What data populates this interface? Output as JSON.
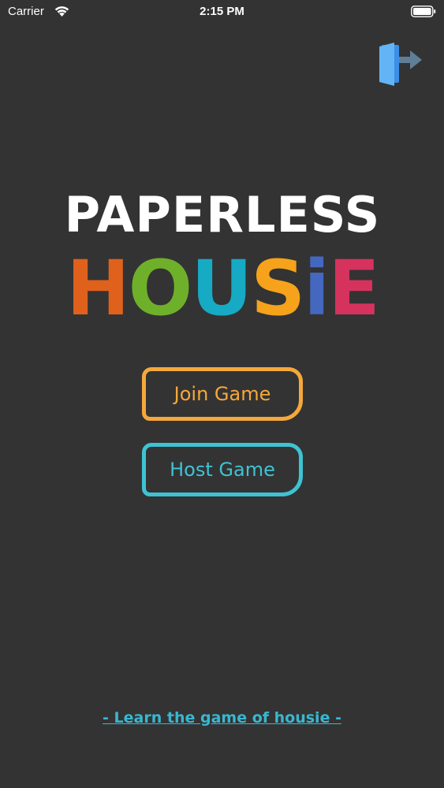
{
  "status_bar": {
    "carrier": "Carrier",
    "time": "2:15 PM",
    "wifi_icon": "wifi-icon",
    "battery_icon": "battery-icon"
  },
  "header": {
    "exit_icon": "exit-door-icon"
  },
  "logo": {
    "line1": "PAPERLESS",
    "letters": [
      {
        "char": "H",
        "color": "#e0611c"
      },
      {
        "char": "O",
        "color": "#6fb02a"
      },
      {
        "char": "U",
        "color": "#16aac4"
      },
      {
        "char": "S",
        "color": "#f6a21b"
      },
      {
        "char": "i",
        "color": "#4468c0"
      },
      {
        "char": "E",
        "color": "#d5335d"
      }
    ]
  },
  "buttons": {
    "join_label": "Join Game",
    "host_label": "Host Game"
  },
  "footer": {
    "learn_link": "- Learn the game of housie -"
  },
  "colors": {
    "background": "#333334",
    "join_accent": "#f5a83a",
    "host_accent": "#3ec3d3",
    "link": "#37b8d0"
  }
}
